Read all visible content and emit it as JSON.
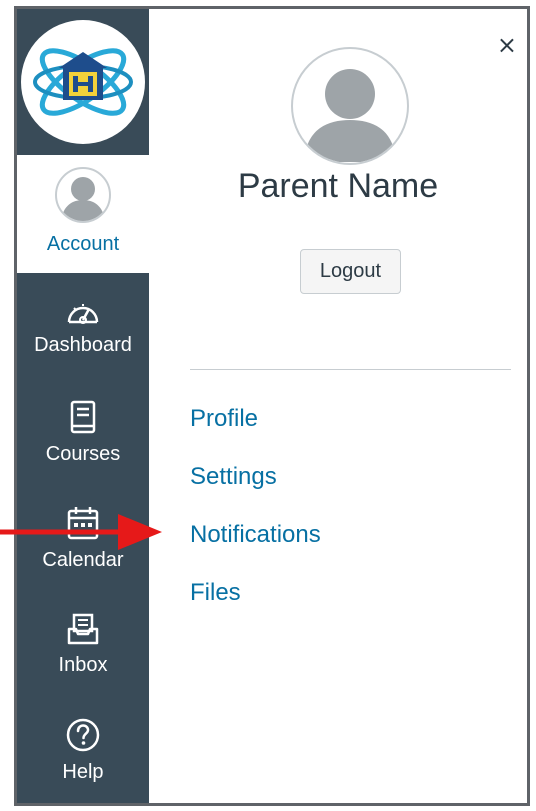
{
  "sidebar": {
    "logo_icon": "school-logo-icon",
    "account": {
      "label": "Account",
      "icon": "user-avatar-icon"
    },
    "items": [
      {
        "label": "Dashboard",
        "icon": "dashboard-gauge-icon"
      },
      {
        "label": "Courses",
        "icon": "book-icon"
      },
      {
        "label": "Calendar",
        "icon": "calendar-icon"
      },
      {
        "label": "Inbox",
        "icon": "inbox-tray-icon"
      },
      {
        "label": "Help",
        "icon": "help-question-icon"
      }
    ]
  },
  "tray": {
    "close_icon": "close-icon",
    "close_label": "×",
    "name": "Parent Name",
    "logout_label": "Logout",
    "links": [
      {
        "label": "Profile"
      },
      {
        "label": "Settings"
      },
      {
        "label": "Notifications"
      },
      {
        "label": "Files"
      }
    ]
  },
  "annotation": {
    "arrow_color": "#e61919",
    "points_to": "Notifications"
  },
  "colors": {
    "sidebar_bg": "#394b58",
    "link": "#0770a3",
    "text": "#2d3b45",
    "divider": "#c7cdd1"
  }
}
